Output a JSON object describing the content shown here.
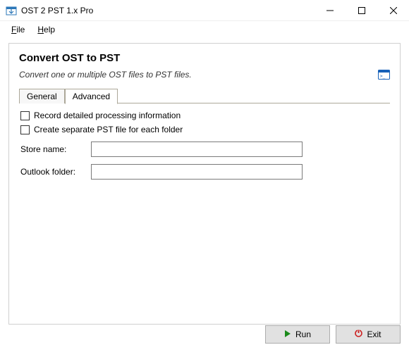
{
  "window": {
    "title": "OST 2 PST 1.x Pro"
  },
  "menu": {
    "file": "File",
    "help": "Help"
  },
  "panel": {
    "heading": "Convert OST to PST",
    "subhead": "Convert one or multiple OST files to PST files."
  },
  "tabs": {
    "general": "General",
    "advanced": "Advanced"
  },
  "advanced": {
    "record_detailed": "Record detailed processing information",
    "create_separate": "Create separate PST file for each folder",
    "store_name_label": "Store name:",
    "store_name_value": "",
    "outlook_folder_label": "Outlook folder:",
    "outlook_folder_value": ""
  },
  "buttons": {
    "run": "Run",
    "exit": "Exit"
  }
}
